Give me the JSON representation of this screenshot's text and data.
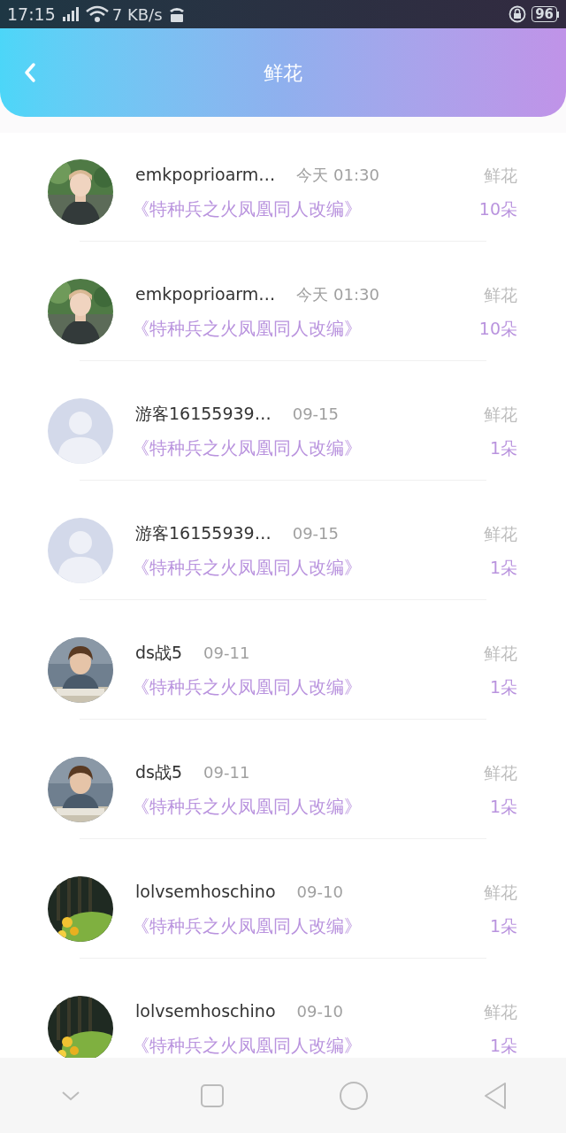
{
  "status_bar": {
    "time": "17:15",
    "speed": "7 KB/s",
    "battery": "96"
  },
  "header": {
    "title": "鲜花"
  },
  "rows": [
    {
      "name": "emkpoprioarm…",
      "time": "今天 01:30",
      "book": "《特种兵之火凤凰同人改编》",
      "gift": "鲜花",
      "count": "10朵"
    },
    {
      "name": "emkpoprioarm…",
      "time": "今天 01:30",
      "book": "《特种兵之火凤凰同人改编》",
      "gift": "鲜花",
      "count": "10朵"
    },
    {
      "avatar": {
        "kind": "placeholder"
      },
      "name": "游客16155939…",
      "time": "09-15",
      "book": "《特种兵之火凤凰同人改编》",
      "gift": "鲜花",
      "count": "1朵"
    },
    {
      "avatar": {
        "kind": "placeholder"
      },
      "name": "游客16155939…",
      "time": "09-15",
      "book": "《特种兵之火凤凰同人改编》",
      "gift": "鲜花",
      "count": "1朵"
    },
    {
      "name": "ds战5",
      "time": "09-11",
      "book": "《特种兵之火凤凰同人改编》",
      "gift": "鲜花",
      "count": "1朵"
    },
    {
      "name": "ds战5",
      "time": "09-11",
      "book": "《特种兵之火凤凰同人改编》",
      "gift": "鲜花",
      "count": "1朵"
    },
    {
      "name": "lolvsemhoschino",
      "time": "09-10",
      "book": "《特种兵之火凤凰同人改编》",
      "gift": "鲜花",
      "count": "1朵"
    },
    {
      "name": "lolvsemhoschino",
      "time": "09-10",
      "book": "《特种兵之火凤凰同人改编》",
      "gift": "鲜花",
      "count": "1朵"
    }
  ]
}
